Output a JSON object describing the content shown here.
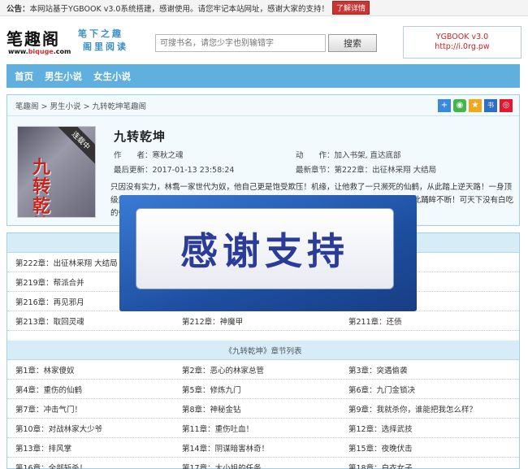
{
  "topbar": {
    "prefix": "公告：",
    "notice": "本网站基于YGBOOK v3.0系统搭建，感谢使用。请您牢记本站网址，感谢大家的支持！",
    "detail_button": "了解详情"
  },
  "header": {
    "logo": "笔趣阁",
    "logo_url_prefix": "www.",
    "logo_url_brand": "biquge",
    "logo_url_suffix": ".com",
    "slogan_line1": "笔下之趣",
    "slogan_line2": "阁里阅读",
    "search_placeholder": "可搜书名，请您少字也别输错字",
    "search_button": "搜索",
    "promo_line1": "YGBOOK v3.0",
    "promo_line2": "http://i.0rg.pw"
  },
  "nav": {
    "items": [
      "首页",
      "男生小说",
      "女生小说"
    ]
  },
  "book": {
    "breadcrumb": "笔趣阁 > 男生小说 > 九转乾坤笔趣阁",
    "cover_ribbon": "连载中",
    "cover_title": "九转乾坤",
    "title": "九转乾坤",
    "author_label": "作　　者：",
    "author": "寒秋之魂",
    "action_label": "动　　作：",
    "action": "加入书架, 直达底部",
    "updated_label": "最后更新：",
    "updated": "2017-01-13 23:58:24",
    "latest_label": "最新章节：",
    "latest": "第222章：出征林采翔 大结局",
    "intro": "只因没有实力，林翥一家世代为奴，他自己更是饱受欺压！机缘，让他救了一只濒死的仙鹤，从此踏上逆天路！一身顶级武技，一颗智慧之心，崛起于微末，震撼四方...... 从此踏上逆天路，一路高歌猛进，从此踊眸不断！可天下没有白吃的午餐……"
  },
  "share_icons": [
    "plus-icon",
    "wechat-icon",
    "star-icon",
    "bookmark-icon",
    "weibo-icon"
  ],
  "latest_section": {
    "rows": [
      [
        "第222章：出征林采翔 大结局",
        "",
        ""
      ],
      [
        "第219章：帮派合并",
        "",
        ""
      ],
      [
        "第216章：再见邪月",
        "",
        ""
      ],
      [
        "第213章：取回灵魂",
        "第212章：神魔甲",
        "第211章：还债"
      ]
    ]
  },
  "list_section": {
    "title": "《九转乾坤》章节列表",
    "rows": [
      [
        "第1章：林家傻奴",
        "第2章：恶心的林家总管",
        "第3章：突遇偷袭"
      ],
      [
        "第4章：重伤的仙鹤",
        "第5章：修炼九门",
        "第6章：九门金锁决"
      ],
      [
        "第7章：冲击气门！",
        "第8章：神秘金钻",
        "第9章：我就杀你，谁能把我怎么样？"
      ],
      [
        "第10章：对战林家大少爷",
        "第11章：重伤吐血！",
        "第12章：选择武技"
      ],
      [
        "第13章：排风掌",
        "第14章：阴谋暗害林奇！",
        "第15章：夜晚伏击"
      ],
      [
        "第16章：全部斩杀！",
        "第17章：大小姐的任务",
        "第18章：白衣女子"
      ]
    ]
  },
  "overlay": {
    "text": "感谢支持"
  },
  "colors": {
    "nav": "#5fb0de",
    "panel_border": "#9fd0e8",
    "overlay_text": "#2a3c96"
  }
}
